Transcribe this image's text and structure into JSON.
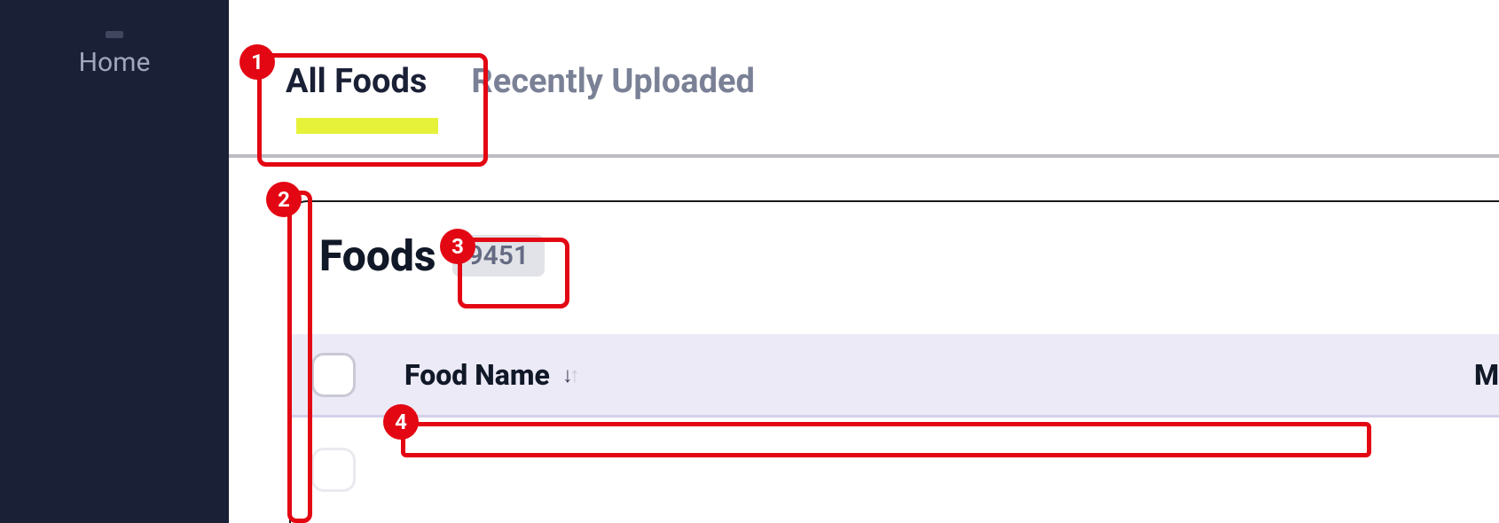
{
  "sidebar": {
    "items": [
      {
        "label": "Home"
      }
    ]
  },
  "tabs": [
    {
      "label": "All Foods",
      "active": true
    },
    {
      "label": "Recently Uploaded",
      "active": false
    }
  ],
  "card": {
    "title": "Foods",
    "count": "9451"
  },
  "table": {
    "columns": [
      {
        "label": "Food Name"
      },
      {
        "label": "M"
      }
    ]
  },
  "annotations": {
    "m1": "1",
    "m2": "2",
    "m3": "3",
    "m4": "4"
  }
}
